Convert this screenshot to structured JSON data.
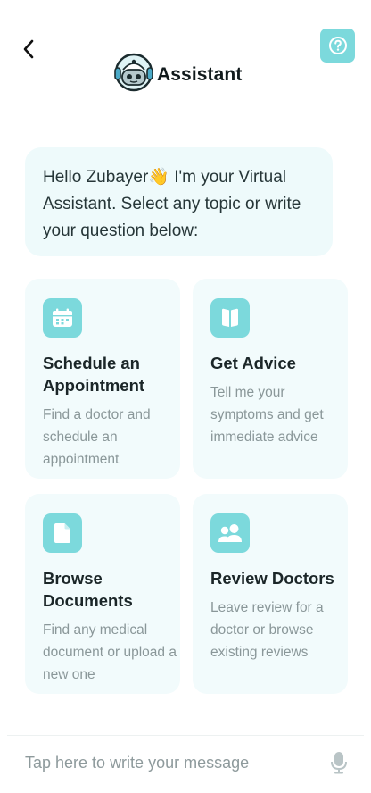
{
  "header": {
    "title": "Assistant",
    "back_icon": "chevron-left-icon",
    "help_icon": "question-circle-icon",
    "logo": "robot-headset-avatar"
  },
  "greeting": {
    "text": "Hello Zubayer👋 I'm your Virtual Assistant. Select any topic or write your question below:"
  },
  "cards": [
    {
      "icon": "calendar-icon",
      "title": "Schedule an Appointment",
      "description": "Find a doctor and schedule an appointment"
    },
    {
      "icon": "book-icon",
      "title": "Get Advice",
      "description": "Tell me your symptoms and get immediate advice"
    },
    {
      "icon": "document-icon",
      "title": "Browse Documents",
      "description": "Find any medical document or upload a new one"
    },
    {
      "icon": "users-icon",
      "title": "Review Doctors",
      "description": "Leave review for a doctor or browse existing reviews"
    }
  ],
  "composer": {
    "placeholder": "Tap here to write your message",
    "mic_icon": "microphone-icon"
  },
  "colors": {
    "accent": "#7cd9dc",
    "card_bg": "#f2fbfc",
    "bubble_bg": "#eefafb",
    "text_muted": "#8a9799"
  }
}
